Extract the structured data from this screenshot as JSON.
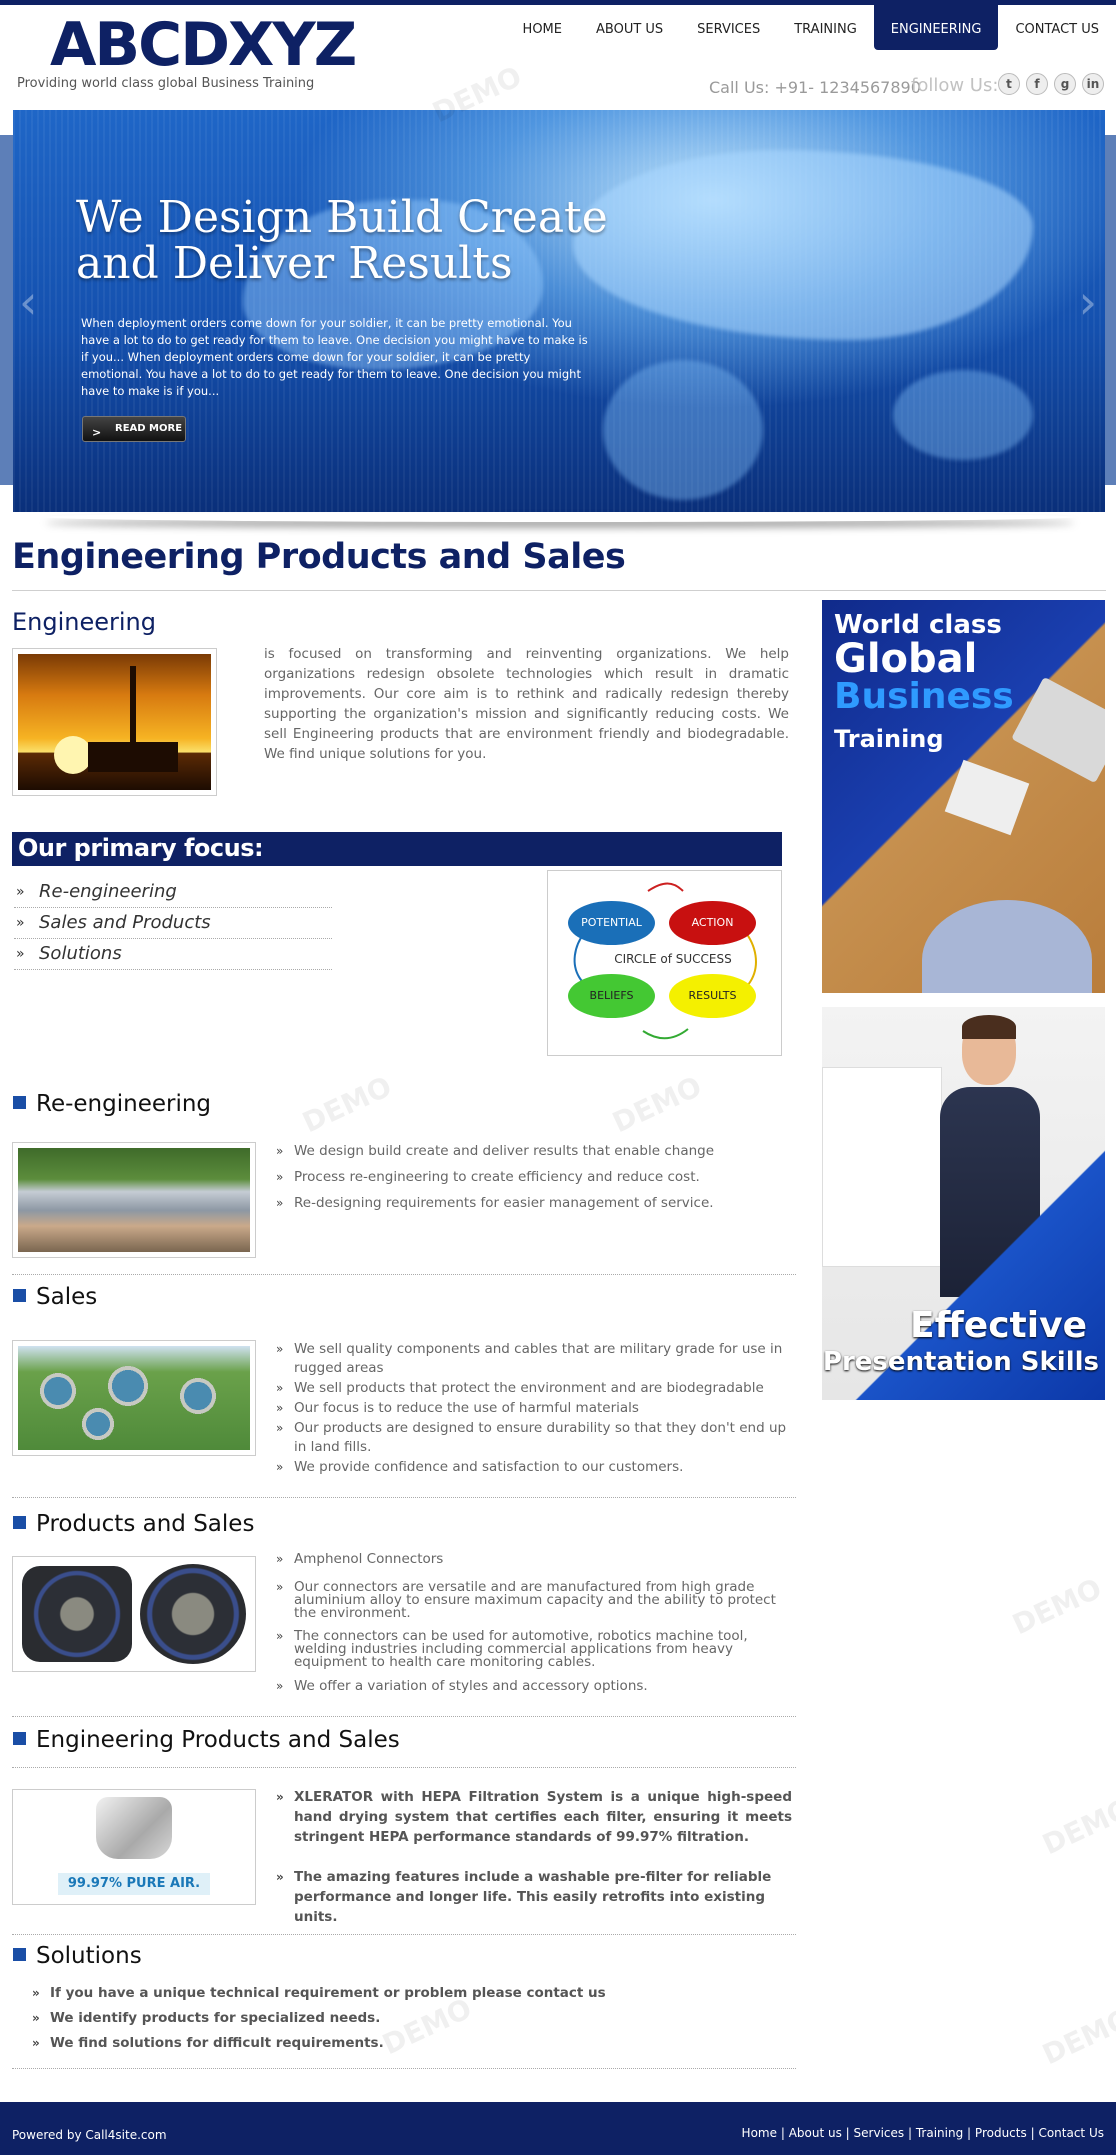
{
  "brand": {
    "logo": "ABCDXYZ",
    "tagline": "Providing world class global Business Training"
  },
  "nav": [
    {
      "label": "HOME"
    },
    {
      "label": "ABOUT US"
    },
    {
      "label": "SERVICES"
    },
    {
      "label": "TRAINING"
    },
    {
      "label": "ENGINEERING",
      "active": true
    },
    {
      "label": "CONTACT US"
    }
  ],
  "contact": {
    "call": "Call Us: +91- 1234567890",
    "follow": "follow Us:"
  },
  "social_icons": [
    "twitter-icon",
    "facebook-icon",
    "google-plus-icon",
    "linkedin-icon"
  ],
  "social_glyphs": [
    "t",
    "f",
    "g",
    "in"
  ],
  "hero": {
    "title_line1": "We Design Build Create",
    "title_line2": "and Deliver Results",
    "text": "When deployment orders come down for your soldier, it can be pretty emotional. You have a lot to do to get ready for them to leave. One decision you might have to make is if you... When deployment orders come down for your soldier, it can be pretty emotional. You have a lot to do to get ready for them to leave. One decision you might have to make is if you...",
    "read_more": "READ MORE",
    "prev_glyph": "‹",
    "next_glyph": "›"
  },
  "page_title": "Engineering Products and Sales",
  "engineering": {
    "heading": "Engineering",
    "text": "is focused on transforming and reinventing organizations. We help  organizations redesign obsolete technologies which result in dramatic improvements. Our core aim is to rethink and radically redesign thereby supporting the organization's mission and significantly reducing costs. We sell Engineering products that are environment friendly and biodegradable. We find unique solutions for you."
  },
  "focus": {
    "heading": "Our primary focus:",
    "items": [
      "Re-engineering",
      "Sales and Products",
      "Solutions"
    ],
    "circle": {
      "potential": "POTENTIAL",
      "action": "ACTION",
      "center": "CIRCLE of SUCCESS",
      "beliefs": "BELIEFS",
      "results": "RESULTS"
    }
  },
  "reengineering": {
    "heading": "Re-engineering",
    "items": [
      "We  design build  create and deliver results that enable change",
      "Process re-engineering to create efficiency and reduce cost.",
      "Re-designing requirements for easier management of service."
    ]
  },
  "sales": {
    "heading": "Sales",
    "items": [
      "We sell quality components and cables that are military grade for use in rugged areas",
      "We sell products that protect  the environment and are biodegradable",
      "Our focus is to reduce the use of harmful materials",
      "Our products are designed to ensure durability so that they don't end up in land fills.",
      "We provide  confidence and satisfaction to our customers."
    ]
  },
  "products": {
    "heading": "Products and Sales",
    "items": [
      "Amphenol Connectors",
      "Our connectors are versatile and are manufactured from high grade aluminium alloy to ensure maximum capacity and the ability to protect the environment.",
      "The connectors can be used for automotive, robotics machine tool, welding industries including commercial  applications from heavy equipment to health care monitoring cables.",
      "We offer a variation of styles and accessory options."
    ]
  },
  "eps": {
    "heading": "Engineering Products and Sales",
    "image_label": "99.97% PURE AIR.",
    "items": [
      "XLERATOR with HEPA Filtration System is a unique high-speed hand drying system that certifies each filter, ensuring it meets stringent HEPA performance standards of 99.97% filtration.",
      "The amazing features include a washable pre-filter for reliable performance and longer life. This easily retrofits into existing units."
    ]
  },
  "solutions": {
    "heading": "Solutions",
    "items": [
      "If you have a unique technical requirement or problem please contact us",
      "We identify products for specialized needs.",
      "We find solutions for difficult requirements."
    ]
  },
  "sidebar": {
    "banner1": {
      "line1": "World class",
      "line2": "Global",
      "line3": "Business",
      "line4": "Training"
    },
    "banner2": {
      "line1": "Effective",
      "line2": "Presentation Skills"
    }
  },
  "bullet_glyph": "»",
  "watermark": "DEMO",
  "footer": {
    "powered": "Powered by Call4site.com",
    "links": [
      "Home",
      "About us",
      "Services",
      "Training",
      "Products",
      "Contact Us"
    ],
    "separator": "|"
  }
}
